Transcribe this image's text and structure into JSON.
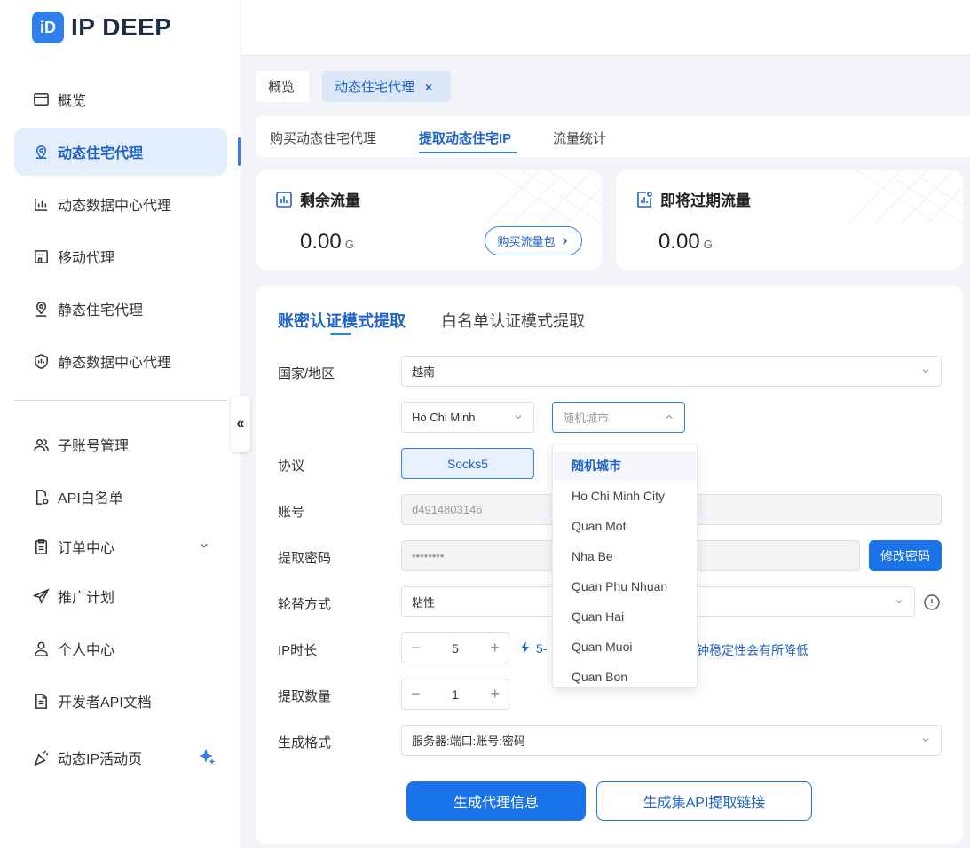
{
  "app": {
    "logo_mark": "iD",
    "logo_text": "IP DEEP"
  },
  "sidebar": {
    "items": [
      {
        "label": "概览",
        "icon": "dashboard-icon"
      },
      {
        "label": "动态住宅代理",
        "icon": "location-icon",
        "active": true
      },
      {
        "label": "动态数据中心代理",
        "icon": "chart-icon"
      },
      {
        "label": "移动代理",
        "icon": "building-icon"
      },
      {
        "label": "静态住宅代理",
        "icon": "pin-icon"
      },
      {
        "label": "静态数据中心代理",
        "icon": "shield-icon"
      },
      {
        "label": "子账号管理",
        "icon": "users-icon"
      },
      {
        "label": "API白名单",
        "icon": "document-gear-icon"
      },
      {
        "label": "订单中心",
        "icon": "clipboard-icon"
      },
      {
        "label": "推广计划",
        "icon": "send-icon"
      },
      {
        "label": "个人中心",
        "icon": "user-icon"
      },
      {
        "label": "开发者API文档",
        "icon": "file-icon"
      },
      {
        "label": "动态IP活动页",
        "icon": "party-icon"
      }
    ],
    "collapse_label": "«"
  },
  "page_tabs": [
    {
      "label": "概览"
    },
    {
      "label": "动态住宅代理",
      "close": "×"
    }
  ],
  "sub_tabs": [
    "购买动态住宅代理",
    "提取动态住宅IP",
    "流量统计"
  ],
  "stats": {
    "remaining": {
      "title": "剩余流量",
      "value": "0.00",
      "unit": "G",
      "button": "购买流量包"
    },
    "expiring": {
      "title": "即将过期流量",
      "value": "0.00",
      "unit": "G"
    }
  },
  "form": {
    "mode_tabs": [
      "账密认证模式提取",
      "白名单认证模式提取"
    ],
    "country_label": "国家/地区",
    "country_value": "越南",
    "province_value": "Ho Chi Minh",
    "city_placeholder": "随机城市",
    "protocol_label": "协议",
    "protocol_value": "Socks5",
    "account_label": "账号",
    "account_value": "d4914803146",
    "password_label": "提取密码",
    "password_value": "••••••••",
    "change_password": "修改密码",
    "rotation_label": "轮替方式",
    "rotation_value": "粘性",
    "duration_label": "IP时长",
    "duration_value": "5",
    "duration_hint_prefix": "5-",
    "duration_hint_suffix": "钟稳定性会有所降低",
    "quantity_label": "提取数量",
    "quantity_value": "1",
    "format_label": "生成格式",
    "format_value": "服务器:端口:账号:密码",
    "generate": "生成代理信息",
    "generate_api": "生成集API提取链接"
  },
  "city_dropdown": {
    "options": [
      "随机城市",
      "Ho Chi Minh City",
      "Quan Mot",
      "Nha Be",
      "Quan Phu Nhuan",
      "Quan Hai",
      "Quan Muoi",
      "Quan Bon"
    ],
    "selected": "随机城市"
  },
  "colors": {
    "accent": "#1a73e8",
    "active_bg": "#e3eefc",
    "page_bg": "#f2f4f7"
  }
}
